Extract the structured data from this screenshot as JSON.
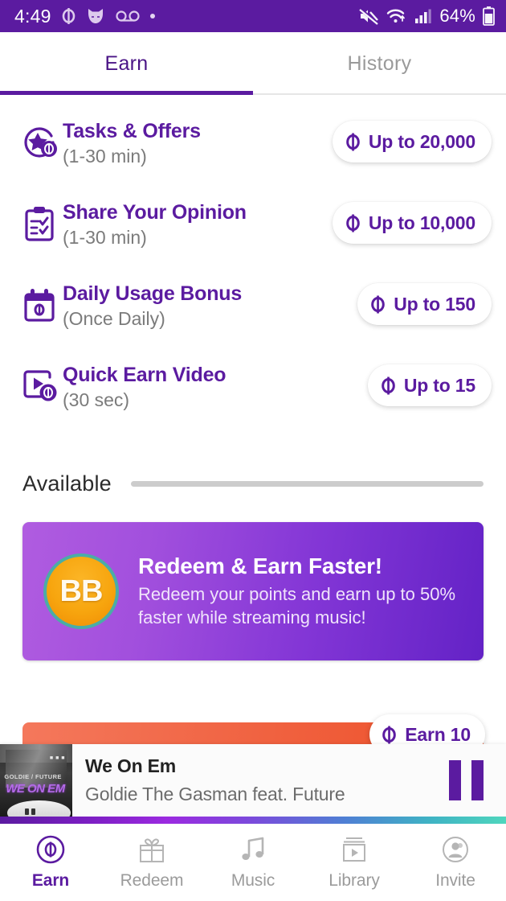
{
  "status_bar": {
    "time": "4:49",
    "battery_percent": "64%",
    "icons": [
      "coin-icon",
      "cat-icon",
      "voicemail-icon",
      "dot-icon",
      "mute-icon",
      "wifi-icon",
      "signal-icon",
      "battery-icon"
    ],
    "background_color": "#5B1BA0"
  },
  "tabs": {
    "items": [
      {
        "label": "Earn",
        "active": true
      },
      {
        "label": "History",
        "active": false
      }
    ],
    "indicator_color": "#5B1BA0"
  },
  "earn_list": [
    {
      "icon": "star-coin-icon",
      "title": "Tasks & Offers",
      "subtitle": "(1-30 min)",
      "reward": "Up to 20,000"
    },
    {
      "icon": "clipboard-check-icon",
      "title": "Share Your Opinion",
      "subtitle": "(1-30 min)",
      "reward": "Up to 10,000"
    },
    {
      "icon": "calendar-coin-icon",
      "title": "Daily Usage Bonus",
      "subtitle": "(Once Daily)",
      "reward": "Up to 150"
    },
    {
      "icon": "video-coin-icon",
      "title": "Quick Earn Video",
      "subtitle": "(30 sec)",
      "reward": "Up to 15"
    }
  ],
  "available_section": {
    "label": "Available"
  },
  "promo_banner": {
    "badge_text": "BB",
    "title": "Redeem & Earn Faster!",
    "subtitle": "Redeem your points and earn up to 50% faster while streaming music!",
    "gradient_from": "#b05ce0",
    "gradient_to": "#6322c6",
    "badge_color": "#f7a50e",
    "badge_ring_color": "#4aada6"
  },
  "offer_card": {
    "earn_badge": "Earn 10",
    "gradient_from": "#f4785c",
    "gradient_to": "#ed4f28"
  },
  "mini_player": {
    "track_title": "We On Em",
    "artist": "Goldie The Gasman feat. Future",
    "album_art_credit": "GOLDIE / FUTURE",
    "album_art_title": "WE ON EM",
    "album_art_tiny": "■ ■ ■",
    "control": "pause-button"
  },
  "bottom_nav": {
    "items": [
      {
        "label": "Earn",
        "icon": "coin-circle-icon",
        "active": true
      },
      {
        "label": "Redeem",
        "icon": "gift-icon",
        "active": false
      },
      {
        "label": "Music",
        "icon": "music-note-icon",
        "active": false
      },
      {
        "label": "Library",
        "icon": "library-video-icon",
        "active": false
      },
      {
        "label": "Invite",
        "icon": "person-circle-icon",
        "active": false
      }
    ],
    "active_color": "#5B1BA0",
    "inactive_color": "#9b9b9b"
  }
}
